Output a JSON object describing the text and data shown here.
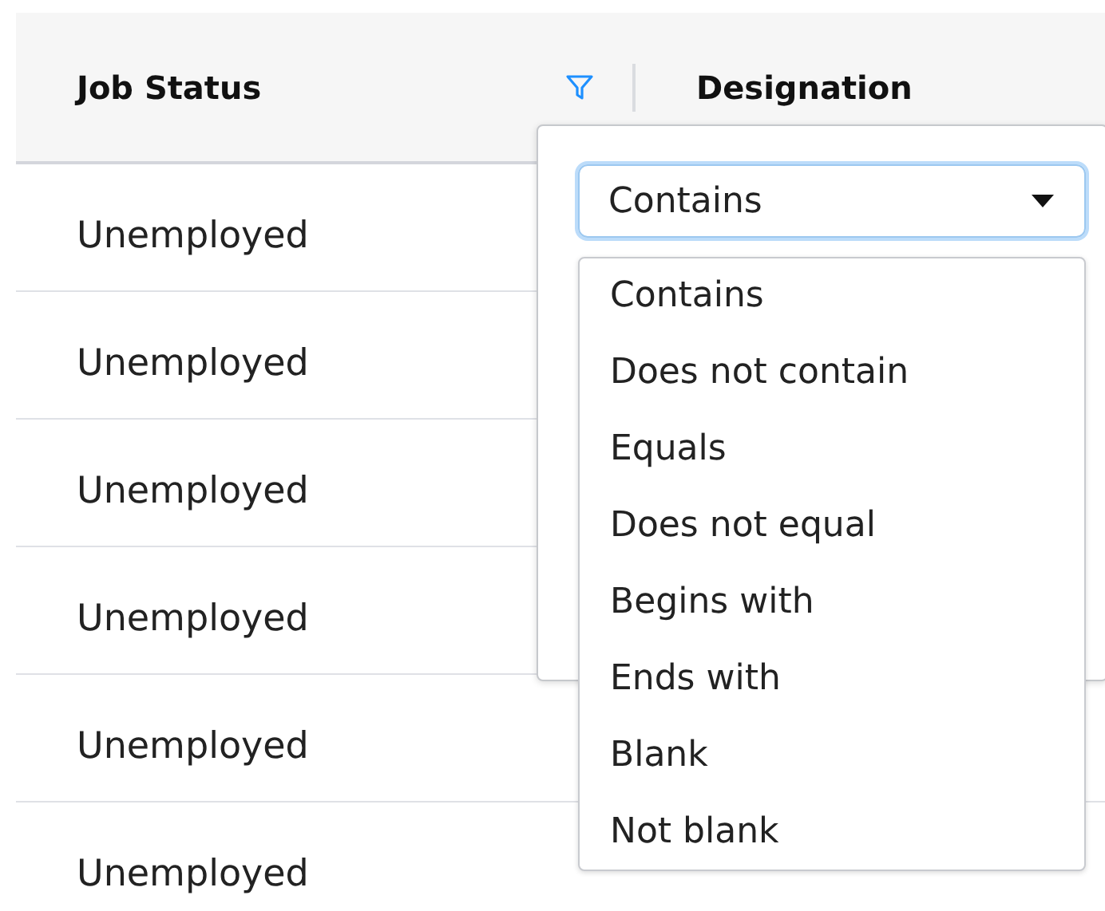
{
  "table": {
    "columns": [
      {
        "title": "Job Status",
        "filter_icon": true
      },
      {
        "title": "Designation",
        "filter_icon": false
      }
    ],
    "rows": [
      {
        "job_status": "Unemployed"
      },
      {
        "job_status": "Unemployed"
      },
      {
        "job_status": "Unemployed"
      },
      {
        "job_status": "Unemployed"
      },
      {
        "job_status": "Unemployed"
      },
      {
        "job_status": "Unemployed"
      }
    ]
  },
  "filter_popup": {
    "condition": {
      "value": "Contains",
      "expanded": true
    },
    "options": [
      "Contains",
      "Does not contain",
      "Equals",
      "Does not equal",
      "Begins with",
      "Ends with",
      "Blank",
      "Not blank"
    ]
  }
}
